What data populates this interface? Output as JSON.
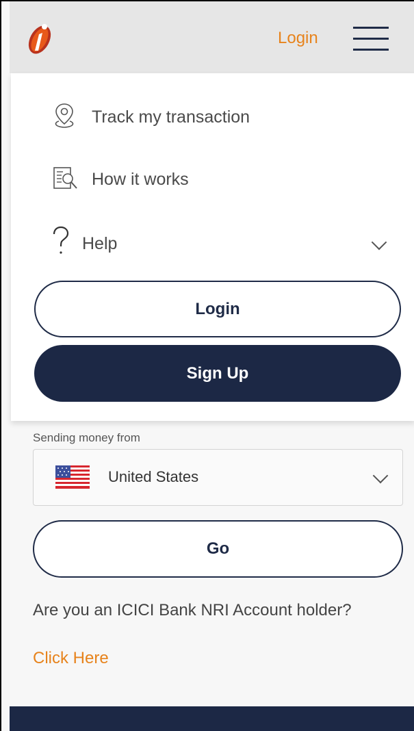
{
  "header": {
    "login_label": "Login"
  },
  "menu": {
    "items": [
      {
        "label": "Track my transaction",
        "icon": "location-pin-icon"
      },
      {
        "label": "How it works",
        "icon": "document-search-icon"
      },
      {
        "label": "Help",
        "icon": "question-mark-icon"
      }
    ],
    "login_button": "Login",
    "signup_button": "Sign Up"
  },
  "main": {
    "sending_label": "Sending money from",
    "country": "United States",
    "go_button": "Go",
    "nri_text": "Are you an ICICI Bank NRI Account holder?",
    "click_here": "Click Here"
  },
  "colors": {
    "accent": "#e7831c",
    "navy": "#1c2845",
    "header_bg": "#e6e6e6"
  }
}
